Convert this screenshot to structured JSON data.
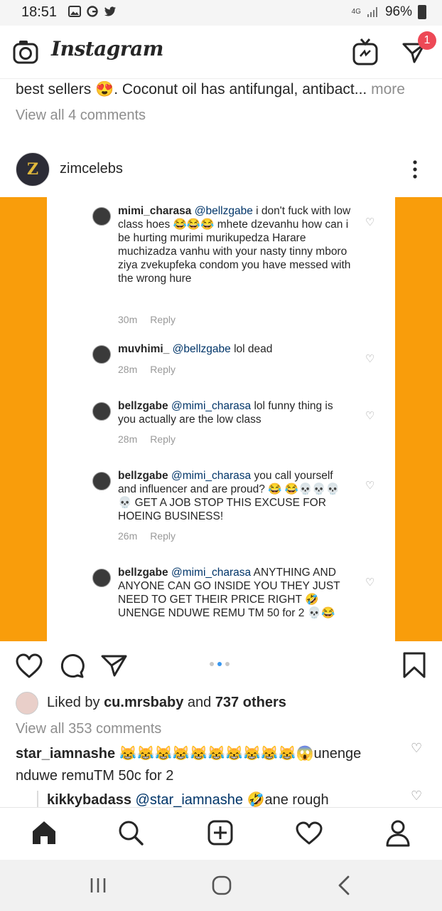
{
  "status_bar": {
    "time": "18:51",
    "network": "4G",
    "battery": "96%"
  },
  "header": {
    "app_name": "Instagram",
    "dm_badge": "1"
  },
  "previous_post": {
    "caption": "best sellers 😍. Coconut oil has antifungal, antibact...",
    "more": " more",
    "view_comments": "View all 4 comments"
  },
  "post": {
    "username": "zimcelebs",
    "avatar_letter": "Z",
    "menu": "⋮"
  },
  "screenshot_comments": [
    {
      "user": "mimi_charasa",
      "mention": "@bellzgabe",
      "text": " i don't fuck with low class hoes 😂😂😂 mhete dzevanhu  how can i be hurting murimi murikupedza Harare muchizadza vanhu with your nasty tinny mboro ziya zvekupfeka condom you have messed with the wrong hure",
      "time": "30m",
      "reply": "Reply"
    },
    {
      "user": "muvhimi_",
      "mention": "@bellzgabe",
      "text": " lol dead",
      "time": "28m",
      "reply": "Reply"
    },
    {
      "user": "bellzgabe",
      "mention": "@mimi_charasa",
      "text": " lol funny thing is you actually are the low class",
      "time": "28m",
      "reply": "Reply"
    },
    {
      "user": "bellzgabe",
      "mention": "@mimi_charasa",
      "text": " you call yourself and influencer and are proud? 😂 😂💀💀💀💀 GET A JOB STOP THIS EXCUSE FOR HOEING BUSINESS!",
      "time": "26m",
      "reply": "Reply"
    },
    {
      "user": "bellzgabe",
      "mention": "@mimi_charasa",
      "text": " ANYTHING AND ANYONE CAN GO INSIDE YOU THEY JUST NEED TO GET THEIR PRICE RIGHT 🤣 UNENGE NDUWE REMU TM 50 for 2 💀😂",
      "time": "",
      "reply": ""
    }
  ],
  "likes": {
    "prefix": "Liked by ",
    "user": "cu.mrsbaby",
    "middle": " and ",
    "others": "737 others"
  },
  "view_all_comments": "View all 353 comments",
  "comments": [
    {
      "user": "star_iamnashe",
      "text": " 😹😹😹😹😹😹😹😹😹😹😱unenge nduwe remuTM 50c for 2"
    },
    {
      "user": "kikkybadass",
      "mention": "@star_iamnashe",
      "text": " 🤣ane rough"
    }
  ],
  "colors": {
    "accent": "#f99d0b",
    "badge": "#ed4956",
    "link": "#003569",
    "dot_active": "#3897f0"
  },
  "icons": [
    "camera-icon",
    "igtv-icon",
    "direct-icon",
    "more-icon",
    "heart-icon",
    "comment-icon",
    "share-icon",
    "bookmark-icon",
    "home-icon",
    "search-icon",
    "add-icon",
    "activity-icon",
    "profile-icon",
    "recents-icon",
    "home-button-icon",
    "back-icon"
  ]
}
